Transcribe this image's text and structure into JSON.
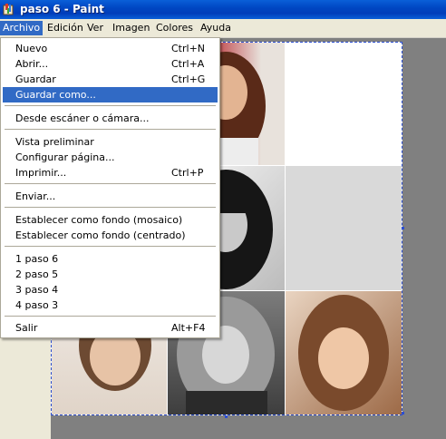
{
  "window": {
    "title": "paso 6 - Paint"
  },
  "menubar": [
    "Archivo",
    "Edición",
    "Ver",
    "Imagen",
    "Colores",
    "Ayuda"
  ],
  "archivo_menu": {
    "items": [
      {
        "label": "Nuevo",
        "shortcut": "Ctrl+N"
      },
      {
        "label": "Abrir...",
        "shortcut": "Ctrl+A"
      },
      {
        "label": "Guardar",
        "shortcut": "Ctrl+G"
      },
      {
        "label": "Guardar como...",
        "shortcut": ""
      },
      {
        "label": "Desde escáner o cámara...",
        "shortcut": ""
      },
      {
        "label": "Vista preliminar",
        "shortcut": ""
      },
      {
        "label": "Configurar página...",
        "shortcut": ""
      },
      {
        "label": "Imprimir...",
        "shortcut": "Ctrl+P"
      },
      {
        "label": "Enviar...",
        "shortcut": ""
      },
      {
        "label": "Establecer como fondo (mosaico)",
        "shortcut": ""
      },
      {
        "label": "Establecer como fondo (centrado)",
        "shortcut": ""
      },
      {
        "label": "1 paso 6",
        "shortcut": ""
      },
      {
        "label": "2 paso 5",
        "shortcut": ""
      },
      {
        "label": "3 paso 4",
        "shortcut": ""
      },
      {
        "label": "4 paso 3",
        "shortcut": ""
      },
      {
        "label": "Salir",
        "shortcut": "Alt+F4"
      }
    ],
    "highlighted": "Guardar como..."
  },
  "colors": {
    "titlebar": "#0047c3",
    "highlight": "#316ac5",
    "workspace": "#808080",
    "selection_border": "#2c4fd1"
  }
}
